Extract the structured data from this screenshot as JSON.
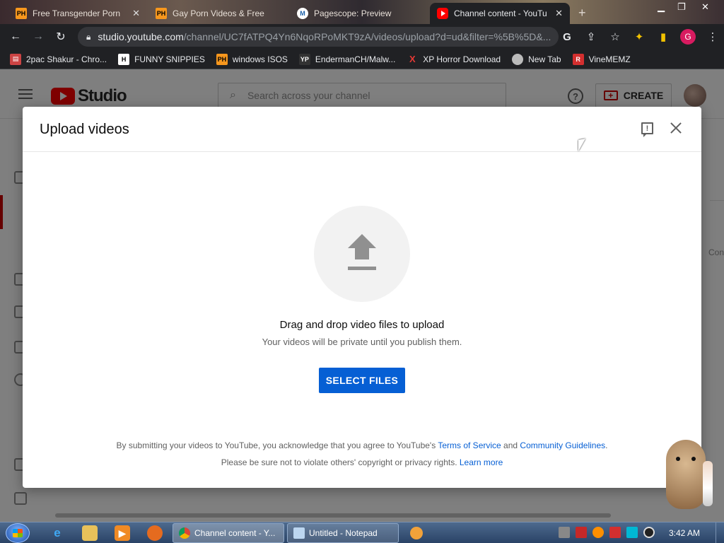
{
  "browser": {
    "tabs": [
      {
        "title": "Free Transgender Porn",
        "favicon": "PH",
        "active": false
      },
      {
        "title": "Gay Porn Videos & Free",
        "favicon": "PH",
        "active": false
      },
      {
        "title": "Pagescope: Preview",
        "favicon": "M",
        "active": false
      },
      {
        "title": "Channel content - YouTu",
        "favicon": "youtube-icon",
        "active": true
      }
    ],
    "url_host": "studio.youtube.com",
    "url_path": "/channel/UC7fATPQ4Yn6NqoRPoMKT9zA/videos/upload?d=ud&filter=%5B%5D&...",
    "profile_initial": "G",
    "bookmarks": [
      {
        "label": "2pac Shakur - Chro...",
        "icon": "page-icon"
      },
      {
        "label": "FUNNY SNIPPIES",
        "icon": "H"
      },
      {
        "label": "windows ISOS",
        "icon": "PH"
      },
      {
        "label": "EndermanCH/Malw...",
        "icon": "YP"
      },
      {
        "label": "XP Horror Download",
        "icon": "X"
      },
      {
        "label": "New Tab",
        "icon": "globe-icon"
      },
      {
        "label": "VineMEMZ",
        "icon": "R"
      }
    ]
  },
  "studio": {
    "logo_text": "Studio",
    "search_placeholder": "Search across your channel",
    "create_label": "CREATE",
    "ghost_text": "Con"
  },
  "dialog": {
    "title": "Upload videos",
    "drag_text": "Drag and drop video files to upload",
    "sub_text": "Your videos will be private until you publish them.",
    "select_files_label": "SELECT FILES",
    "legal_line1_pre": "By submitting your videos to YouTube, you acknowledge that you agree to YouTube's ",
    "terms_link": "Terms of Service",
    "legal_and": " and ",
    "guidelines_link": "Community Guidelines",
    "legal_period": ".",
    "legal_line2_pre": "Please be sure not to violate others' copyright or privacy rights. ",
    "learn_more_link": "Learn more"
  },
  "taskbar": {
    "tasks": [
      {
        "label": "Channel content - Y...",
        "icon": "chrome-icon"
      },
      {
        "label": "Untitled - Notepad",
        "icon": "notepad-icon"
      }
    ],
    "clock": "3:42 AM"
  },
  "colors": {
    "accent_blue": "#065fd4",
    "youtube_red": "#ff0000",
    "chrome_dark": "#202124"
  }
}
